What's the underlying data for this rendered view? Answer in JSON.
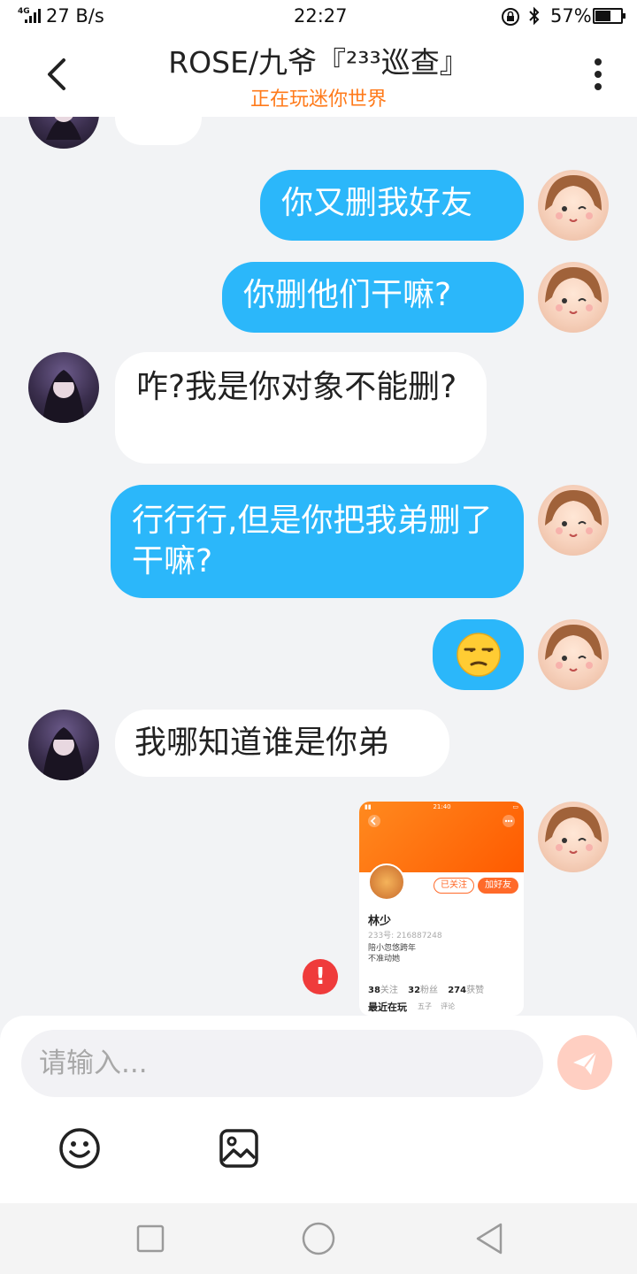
{
  "status_bar": {
    "network": "4G",
    "speed": "27 B/s",
    "time": "22:27",
    "battery": "57%"
  },
  "header": {
    "title": "ROSE/九爷『²³³巡查』",
    "subtitle": "正在玩迷你世界"
  },
  "messages": [
    {
      "from": "other",
      "text": ""
    },
    {
      "from": "self",
      "text": "你又删我好友"
    },
    {
      "from": "self",
      "text": "你删他们干嘛?"
    },
    {
      "from": "other",
      "text": "咋?我是你对象不能删?"
    },
    {
      "from": "self",
      "text": "行行行,但是你把我弟删了干嘛?"
    },
    {
      "from": "self",
      "text": "😒"
    },
    {
      "from": "other",
      "text": "我哪知道谁是你弟"
    }
  ],
  "shared_card": {
    "status_time": "21:40",
    "followed": "已关注",
    "add_friend": "加好友",
    "name": "林少",
    "id": "233号: 216887248",
    "bio_line1": "陪小忽悠跨年",
    "bio_line2": "不准动她",
    "following_count": "38",
    "following_label": "关注",
    "fans_count": "32",
    "fans_label": "粉丝",
    "likes_count": "274",
    "likes_label": "获赞",
    "playing_label": "最近在玩",
    "tag1": "五子",
    "tag2": "评论"
  },
  "input": {
    "placeholder": "请输入..."
  },
  "colors": {
    "accent_orange": "#ff7a1a",
    "self_bubble": "#2bb7fa",
    "error_red": "#ef3b3b"
  },
  "icons": [
    "back-icon",
    "more-icon",
    "error-icon",
    "send-icon",
    "emoji-icon",
    "image-icon",
    "recent-apps-icon",
    "home-icon",
    "back-nav-icon"
  ]
}
